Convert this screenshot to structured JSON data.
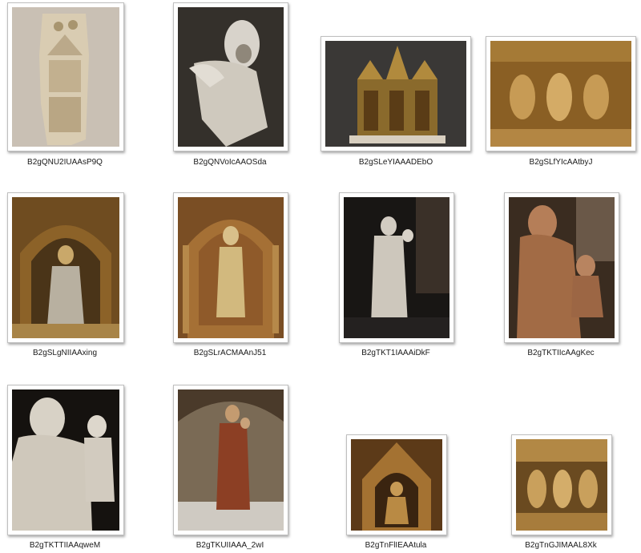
{
  "thumbnails": [
    {
      "label": "B2gQNU2IUAAsP9Q",
      "icon": "ivory-plaque-image"
    },
    {
      "label": "B2gQNVoIcAAOSda",
      "icon": "stone-statue-image"
    },
    {
      "label": "B2gSLeYIAAADEbO",
      "icon": "gilded-reliquary-image"
    },
    {
      "label": "B2gSLfYIcAAtbyJ",
      "icon": "gilded-relief-image"
    },
    {
      "label": "B2gSLgNIIAAxing",
      "icon": "gilded-niche-figure-image"
    },
    {
      "label": "B2gSLrACMAAnJ51",
      "icon": "gilded-standing-figure-image"
    },
    {
      "label": "B2gTKT1IAAAiDkF",
      "icon": "madonna-statue-dark-image"
    },
    {
      "label": "B2gTKTIIcAAgKec",
      "icon": "wooden-madonna-image"
    },
    {
      "label": "B2gTKTTIIAAqweM",
      "icon": "madonna-closeup-image"
    },
    {
      "label": "B2gTKUIIAAA_2wI",
      "icon": "painted-madonna-case-image"
    },
    {
      "label": "B2gTnFlIEAAtula",
      "icon": "gilded-shrine-image"
    },
    {
      "label": "B2gTnGJIMAAL8Xk",
      "icon": "gilded-relief-detail-image"
    }
  ]
}
